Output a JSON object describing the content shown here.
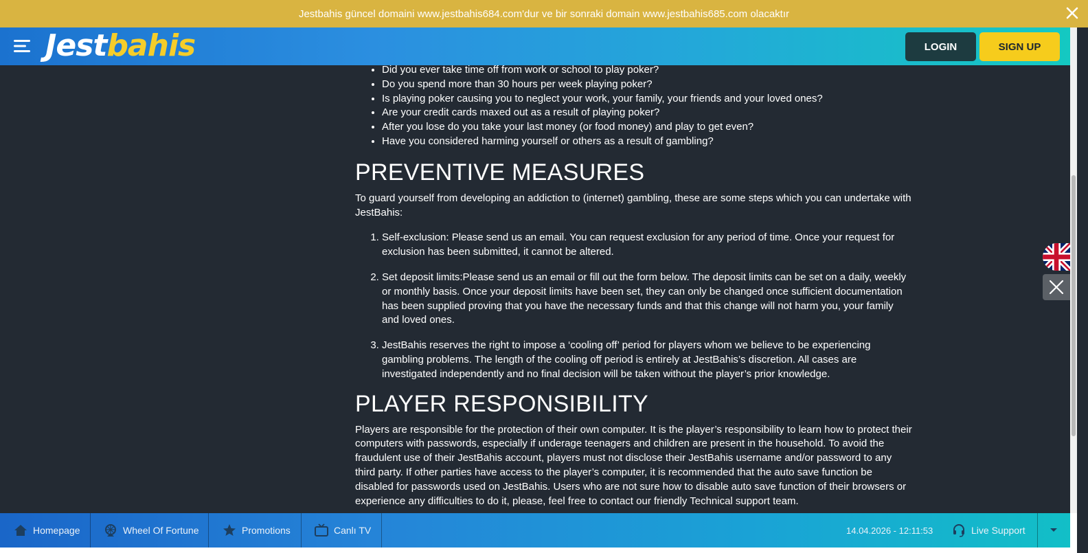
{
  "announcement": {
    "text": "Jestbahis güncel domaini www.jestbahis684.com'dur ve bir sonraki domain www.jestbahis685.com olacaktır"
  },
  "header": {
    "logo_part1": "Jest",
    "logo_part2": "bahis",
    "login_label": "LOGIN",
    "signup_label": "SIGN UP"
  },
  "content": {
    "questions": [
      "Did you ever take time off from work or school to play poker?",
      "Do you spend more than 30 hours per week playing poker?",
      "Is playing poker causing you to neglect your work, your family, your friends and your loved ones?",
      "Are your credit cards maxed out as a result of playing poker?",
      "After you lose do you take your last money (or food money) and play to get even?",
      "Have you considered harming yourself or others as a result of gambling?"
    ],
    "preventive_heading": "PREVENTIVE MEASURES",
    "preventive_intro": "To guard yourself from developing an addiction to (internet) gambling, these are some steps which you can undertake with JestBahis:",
    "preventive_steps": [
      "Self-exclusion: Please send us an email. You can request exclusion for any period of time. Once your request for exclusion has been submitted, it cannot be altered.",
      "Set deposit limits:Please send us an email or fill out the form below. The deposit limits can be set on a daily, weekly or monthly basis. Once your deposit limits have been set, they can only be changed once sufficient documentation has been supplied proving that you have the necessary funds and that this change will not harm you, your family and loved ones.",
      "JestBahis reserves the right to impose a ‘cooling off’ period for players whom we believe to be experiencing gambling problems. The length of the cooling off period is entirely at JestBahis’s discretion. All cases are investigated independently and no final decision will be taken without the player’s prior knowledge."
    ],
    "player_heading": "PLAYER RESPONSIBILITY",
    "player_text": "Players are responsible for the protection of their own computer. It is the player’s responsibility to learn how to protect their computers with passwords, especially if underage teenagers and children are present in the household. To avoid the fraudulent use of their JestBahis account, players must not disclose their JestBahis username and/or password to any third party. If other parties have access to the player’s computer, it is recommended that the auto save function be disabled for passwords used on JestBahis. Users who are not sure how to disable auto save function of their browsers or experience any difficulties to do it, please, feel free to contact our friendly Technical support team."
  },
  "bottom_bar": {
    "items": [
      {
        "label": "Homepage",
        "icon": "home-icon"
      },
      {
        "label": "Wheel Of Fortune",
        "icon": "wheel-icon"
      },
      {
        "label": "Promotions",
        "icon": "star-icon"
      },
      {
        "label": "Canlı TV",
        "icon": "tv-icon"
      }
    ],
    "datetime": "14.04.2026 - 12:11:53",
    "live_support": "Live Support"
  },
  "colors": {
    "banner": "#d9b441",
    "page_background": "#232a33",
    "login_button": "#1d3b40",
    "signup_button": "#f6cc1c",
    "logo_accent": "#f5cd2a"
  }
}
